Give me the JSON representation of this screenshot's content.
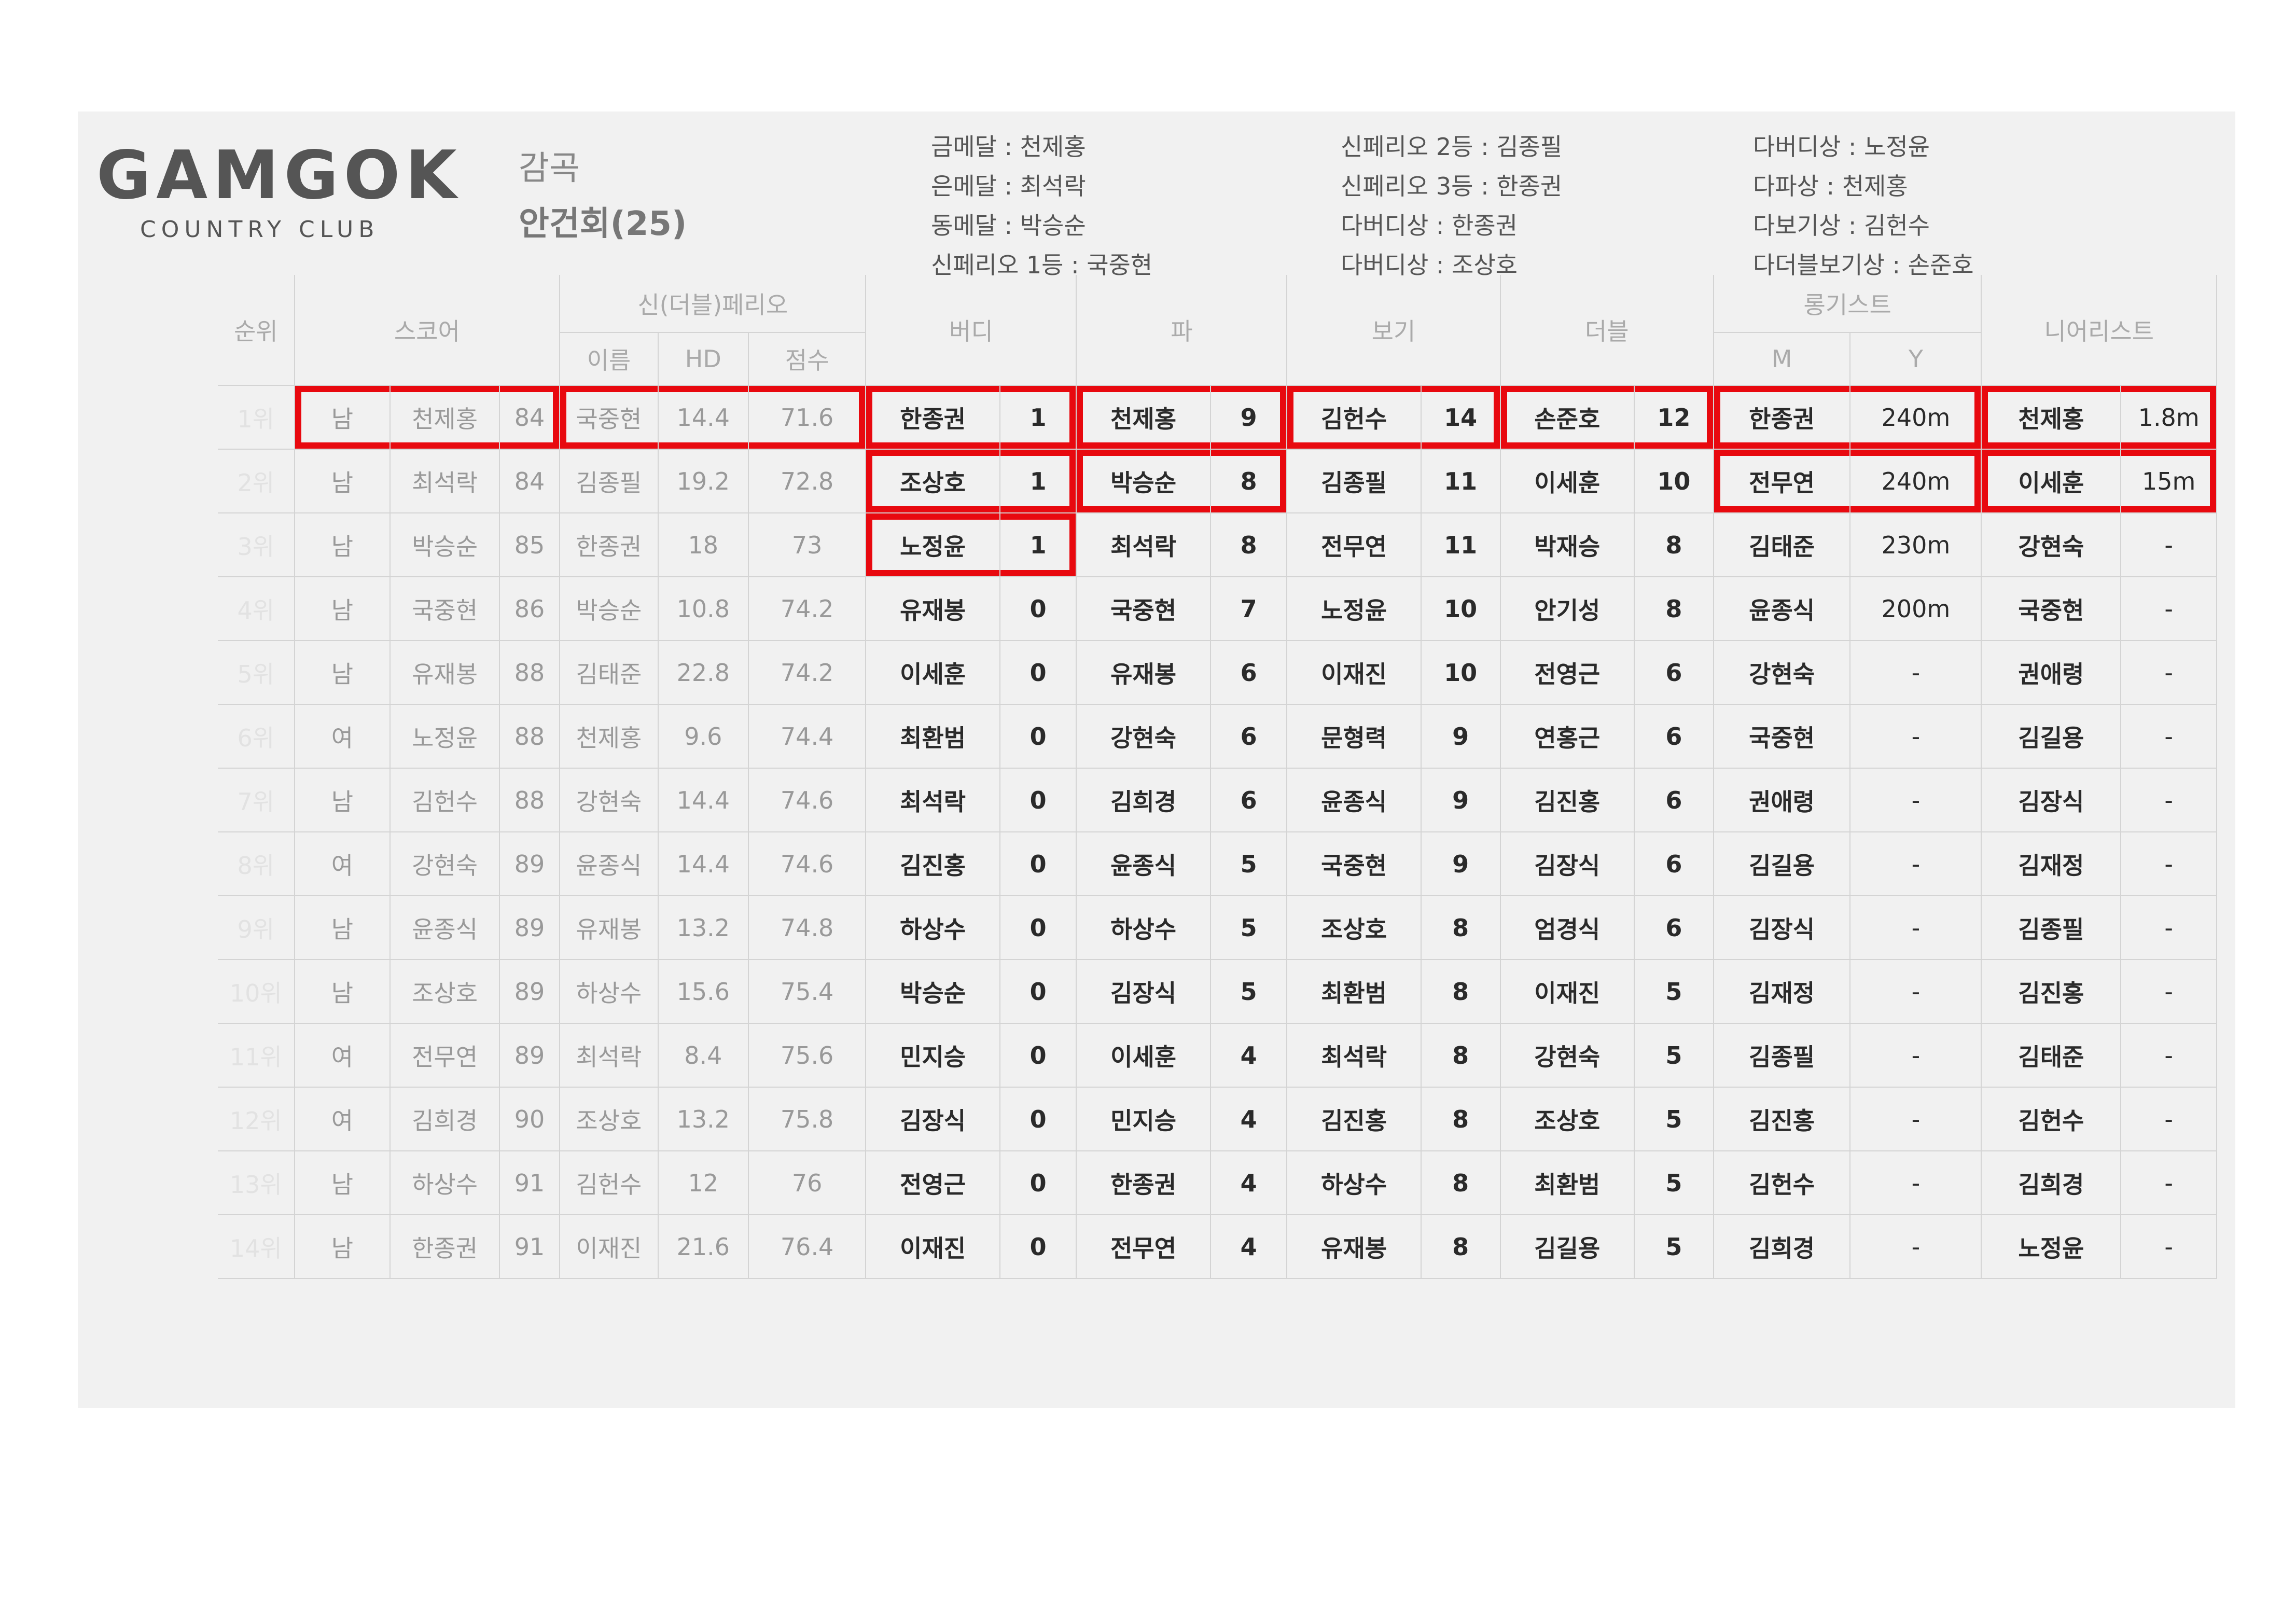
{
  "logo": {
    "main": "GAMGOK",
    "sub": "COUNTRY CLUB"
  },
  "club_name": "감곡",
  "event_title": "안건회(25)",
  "awards": {
    "col1": [
      "금메달 : 천제홍",
      "은메달 : 최석락",
      "동메달 : 박승순",
      "신페리오 1등 : 국중현"
    ],
    "col2": [
      "신페리오 2등 : 김종필",
      "신페리오 3등 : 한종권",
      "다버디상 : 한종권",
      "다버디상 : 조상호"
    ],
    "col3": [
      "다버디상 : 노정윤",
      "다파상 : 천제홍",
      "다보기상 : 김헌수",
      "다더블보기상 : 손준호"
    ]
  },
  "headers": {
    "rank": "순위",
    "score": "스코어",
    "peoria": "신(더블)페리오",
    "peoria_name": "이름",
    "peoria_hd": "HD",
    "peoria_points": "점수",
    "birdie": "버디",
    "par": "파",
    "bogey": "보기",
    "double": "더블",
    "longest": "롱기스트",
    "longest_m": "M",
    "longest_y": "Y",
    "nearest": "니어리스트"
  },
  "rows": [
    {
      "rank": "1위",
      "gender": "남",
      "name": "천제홍",
      "score": "84",
      "p_name": "국중현",
      "p_hd": "14.4",
      "p_pts": "71.6",
      "b_name": "한종권",
      "b_cnt": "1",
      "pa_name": "천제홍",
      "pa_cnt": "9",
      "bo_name": "김헌수",
      "bo_cnt": "14",
      "d_name": "손준호",
      "d_cnt": "12",
      "l_name": "한종권",
      "l_dist": "240m",
      "n_name": "천제홍",
      "n_dist": "1.8m"
    },
    {
      "rank": "2위",
      "gender": "남",
      "name": "최석락",
      "score": "84",
      "p_name": "김종필",
      "p_hd": "19.2",
      "p_pts": "72.8",
      "b_name": "조상호",
      "b_cnt": "1",
      "pa_name": "박승순",
      "pa_cnt": "8",
      "bo_name": "김종필",
      "bo_cnt": "11",
      "d_name": "이세훈",
      "d_cnt": "10",
      "l_name": "전무연",
      "l_dist": "240m",
      "n_name": "이세훈",
      "n_dist": "15m"
    },
    {
      "rank": "3위",
      "gender": "남",
      "name": "박승순",
      "score": "85",
      "p_name": "한종권",
      "p_hd": "18",
      "p_pts": "73",
      "b_name": "노정윤",
      "b_cnt": "1",
      "pa_name": "최석락",
      "pa_cnt": "8",
      "bo_name": "전무연",
      "bo_cnt": "11",
      "d_name": "박재승",
      "d_cnt": "8",
      "l_name": "김태준",
      "l_dist": "230m",
      "n_name": "강현숙",
      "n_dist": "-"
    },
    {
      "rank": "4위",
      "gender": "남",
      "name": "국중현",
      "score": "86",
      "p_name": "박승순",
      "p_hd": "10.8",
      "p_pts": "74.2",
      "b_name": "유재봉",
      "b_cnt": "0",
      "pa_name": "국중현",
      "pa_cnt": "7",
      "bo_name": "노정윤",
      "bo_cnt": "10",
      "d_name": "안기성",
      "d_cnt": "8",
      "l_name": "윤종식",
      "l_dist": "200m",
      "n_name": "국중현",
      "n_dist": "-"
    },
    {
      "rank": "5위",
      "gender": "남",
      "name": "유재봉",
      "score": "88",
      "p_name": "김태준",
      "p_hd": "22.8",
      "p_pts": "74.2",
      "b_name": "이세훈",
      "b_cnt": "0",
      "pa_name": "유재봉",
      "pa_cnt": "6",
      "bo_name": "이재진",
      "bo_cnt": "10",
      "d_name": "전영근",
      "d_cnt": "6",
      "l_name": "강현숙",
      "l_dist": "-",
      "n_name": "권애령",
      "n_dist": "-"
    },
    {
      "rank": "6위",
      "gender": "여",
      "name": "노정윤",
      "score": "88",
      "p_name": "천제홍",
      "p_hd": "9.6",
      "p_pts": "74.4",
      "b_name": "최환범",
      "b_cnt": "0",
      "pa_name": "강현숙",
      "pa_cnt": "6",
      "bo_name": "문형력",
      "bo_cnt": "9",
      "d_name": "연홍근",
      "d_cnt": "6",
      "l_name": "국중현",
      "l_dist": "-",
      "n_name": "김길용",
      "n_dist": "-"
    },
    {
      "rank": "7위",
      "gender": "남",
      "name": "김헌수",
      "score": "88",
      "p_name": "강현숙",
      "p_hd": "14.4",
      "p_pts": "74.6",
      "b_name": "최석락",
      "b_cnt": "0",
      "pa_name": "김희경",
      "pa_cnt": "6",
      "bo_name": "윤종식",
      "bo_cnt": "9",
      "d_name": "김진홍",
      "d_cnt": "6",
      "l_name": "권애령",
      "l_dist": "-",
      "n_name": "김장식",
      "n_dist": "-"
    },
    {
      "rank": "8위",
      "gender": "여",
      "name": "강현숙",
      "score": "89",
      "p_name": "윤종식",
      "p_hd": "14.4",
      "p_pts": "74.6",
      "b_name": "김진홍",
      "b_cnt": "0",
      "pa_name": "윤종식",
      "pa_cnt": "5",
      "bo_name": "국중현",
      "bo_cnt": "9",
      "d_name": "김장식",
      "d_cnt": "6",
      "l_name": "김길용",
      "l_dist": "-",
      "n_name": "김재정",
      "n_dist": "-"
    },
    {
      "rank": "9위",
      "gender": "남",
      "name": "윤종식",
      "score": "89",
      "p_name": "유재봉",
      "p_hd": "13.2",
      "p_pts": "74.8",
      "b_name": "하상수",
      "b_cnt": "0",
      "pa_name": "하상수",
      "pa_cnt": "5",
      "bo_name": "조상호",
      "bo_cnt": "8",
      "d_name": "엄경식",
      "d_cnt": "6",
      "l_name": "김장식",
      "l_dist": "-",
      "n_name": "김종필",
      "n_dist": "-"
    },
    {
      "rank": "10위",
      "gender": "남",
      "name": "조상호",
      "score": "89",
      "p_name": "하상수",
      "p_hd": "15.6",
      "p_pts": "75.4",
      "b_name": "박승순",
      "b_cnt": "0",
      "pa_name": "김장식",
      "pa_cnt": "5",
      "bo_name": "최환범",
      "bo_cnt": "8",
      "d_name": "이재진",
      "d_cnt": "5",
      "l_name": "김재정",
      "l_dist": "-",
      "n_name": "김진홍",
      "n_dist": "-"
    },
    {
      "rank": "11위",
      "gender": "여",
      "name": "전무연",
      "score": "89",
      "p_name": "최석락",
      "p_hd": "8.4",
      "p_pts": "75.6",
      "b_name": "민지승",
      "b_cnt": "0",
      "pa_name": "이세훈",
      "pa_cnt": "4",
      "bo_name": "최석락",
      "bo_cnt": "8",
      "d_name": "강현숙",
      "d_cnt": "5",
      "l_name": "김종필",
      "l_dist": "-",
      "n_name": "김태준",
      "n_dist": "-"
    },
    {
      "rank": "12위",
      "gender": "여",
      "name": "김희경",
      "score": "90",
      "p_name": "조상호",
      "p_hd": "13.2",
      "p_pts": "75.8",
      "b_name": "김장식",
      "b_cnt": "0",
      "pa_name": "민지승",
      "pa_cnt": "4",
      "bo_name": "김진홍",
      "bo_cnt": "8",
      "d_name": "조상호",
      "d_cnt": "5",
      "l_name": "김진홍",
      "l_dist": "-",
      "n_name": "김헌수",
      "n_dist": "-"
    },
    {
      "rank": "13위",
      "gender": "남",
      "name": "하상수",
      "score": "91",
      "p_name": "김헌수",
      "p_hd": "12",
      "p_pts": "76",
      "b_name": "전영근",
      "b_cnt": "0",
      "pa_name": "한종권",
      "pa_cnt": "4",
      "bo_name": "하상수",
      "bo_cnt": "8",
      "d_name": "최환범",
      "d_cnt": "5",
      "l_name": "김헌수",
      "l_dist": "-",
      "n_name": "김희경",
      "n_dist": "-"
    },
    {
      "rank": "14위",
      "gender": "남",
      "name": "한종권",
      "score": "91",
      "p_name": "이재진",
      "p_hd": "21.6",
      "p_pts": "76.4",
      "b_name": "이재진",
      "b_cnt": "0",
      "pa_name": "전무연",
      "pa_cnt": "4",
      "bo_name": "유재봉",
      "bo_cnt": "8",
      "d_name": "김길용",
      "d_cnt": "5",
      "l_name": "김희경",
      "l_dist": "-",
      "n_name": "노정윤",
      "n_dist": "-"
    }
  ]
}
